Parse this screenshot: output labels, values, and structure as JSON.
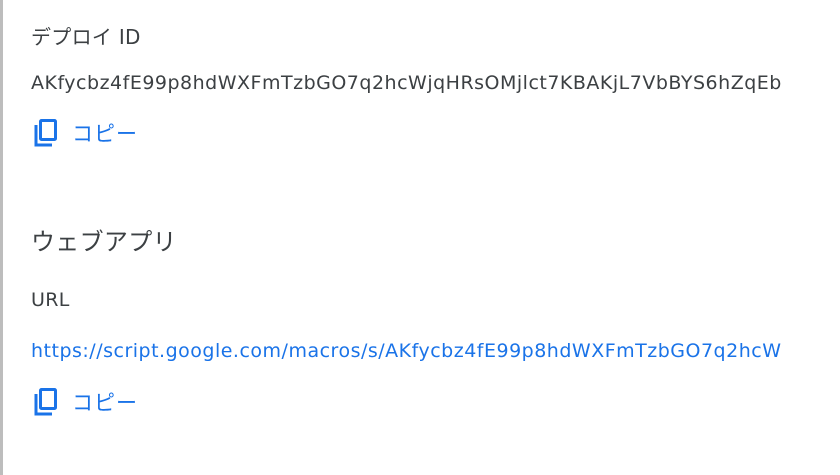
{
  "deployment": {
    "id_label": "デプロイ ID",
    "id_value": "AKfycbz4fE99p8hdWXFmTzbGO7q2hcWjqHRsOMjlct7KBAKjL7VbBYS6hZqEb",
    "copy_label": "コピー"
  },
  "webapp": {
    "title": "ウェブアプリ",
    "url_label": "URL",
    "url_value": "https://script.google.com/macros/s/AKfycbz4fE99p8hdWXFmTzbGO7q2hcW",
    "copy_label": "コピー"
  },
  "icons": {
    "copy": "copy-icon"
  },
  "colors": {
    "accent": "#1a73e8",
    "text": "#3c4043",
    "background": "#ffffff"
  }
}
